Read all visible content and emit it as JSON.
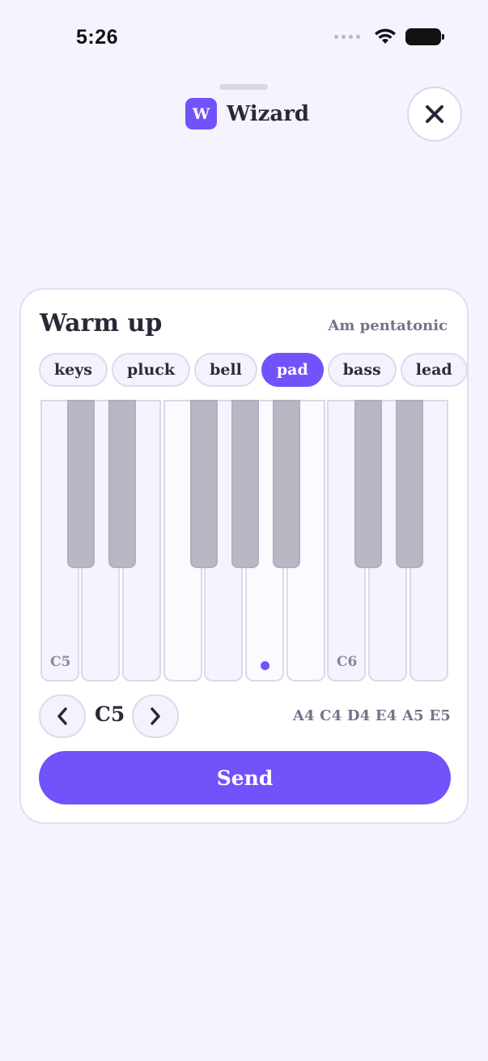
{
  "status_bar": {
    "time": "5:26"
  },
  "header": {
    "logo_letter": "W",
    "app_name": "Wizard"
  },
  "card": {
    "title": "Warm up",
    "scale": "Am pentatonic",
    "chips": [
      {
        "label": "keys",
        "active": false
      },
      {
        "label": "pluck",
        "active": false
      },
      {
        "label": "bell",
        "active": false
      },
      {
        "label": "pad",
        "active": true
      },
      {
        "label": "bass",
        "active": false
      },
      {
        "label": "lead",
        "active": false
      }
    ],
    "piano": {
      "white_keys": [
        "C5",
        "D5",
        "E5",
        "F5",
        "G5",
        "A5",
        "B5",
        "C6",
        "D6",
        "E6"
      ],
      "labels": {
        "C5": "C5",
        "C6": "C6"
      },
      "active_note": "A5"
    },
    "octave": "C5",
    "scale_notes": "A4 C4 D4 E4 A5 E5",
    "send_label": "Send"
  },
  "colors": {
    "accent": "#7252fb",
    "background": "#f5f3fe",
    "text": "#2a2838",
    "muted": "#76738a"
  }
}
